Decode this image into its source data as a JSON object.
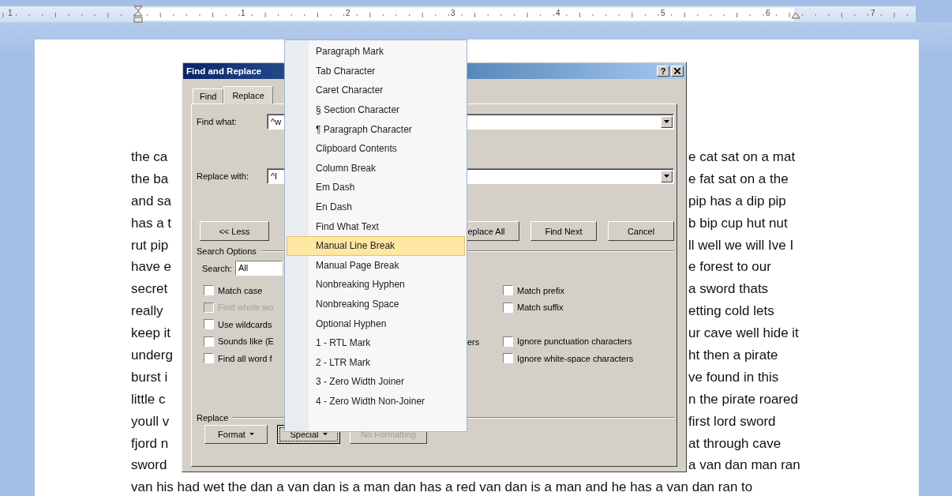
{
  "ruler": {
    "numbers": [
      "1",
      "1",
      "2",
      "3",
      "4",
      "5",
      "6",
      "7"
    ]
  },
  "document": {
    "lines": [
      {
        "left": "the ca",
        "right": "e cat sat on a mat"
      },
      {
        "left": "the ba",
        "right": "e fat sat on a the"
      },
      {
        "left": "and sa",
        "right": "pip has a dip pip"
      },
      {
        "left": "has a t",
        "right": "b bip cup hut nut"
      },
      {
        "left": "rut pip",
        "right": "ll well we will Ive I"
      },
      {
        "left": "have e",
        "right": "e forest to our"
      },
      {
        "left": "secret",
        "right": "a sword thats"
      },
      {
        "left": "really",
        "right": "etting cold lets"
      },
      {
        "left": "keep it",
        "right": "ur cave well hide it"
      },
      {
        "left": "underg",
        "right": "ht then a pirate"
      },
      {
        "left": "burst i",
        "right": "ve found in this"
      },
      {
        "left": "little c",
        "right": "n the pirate roared"
      },
      {
        "left": "youll v",
        "right": "first lord sword"
      },
      {
        "left": "fjord n",
        "right": "at through cave"
      },
      {
        "left": "sword",
        "right": "a van dan man ran"
      }
    ],
    "full_line": "van his had wet the dan a van dan is a man dan has a red van dan is a man and he has a van dan ran to"
  },
  "dialog": {
    "title": "Find and Replace",
    "help": "?",
    "tabs": [
      {
        "label": "Find",
        "selected": false
      },
      {
        "label": "Replace",
        "selected": true
      }
    ],
    "find_label": "Find what:",
    "find_value": "^w",
    "replace_label": "Replace with:",
    "replace_value": "^l",
    "less_button": "<< Less",
    "action_buttons": [
      "eplace All",
      "Find Next",
      "Cancel"
    ],
    "search_options_label": "Search Options",
    "search_label": "Search:",
    "search_value": "All",
    "option_rows": [
      {
        "left": {
          "label": "Match case",
          "checked": false,
          "disabled": false
        },
        "right": {
          "label": "Match prefix",
          "checked": false,
          "disabled": false
        }
      },
      {
        "left": {
          "label": "Find whole wo",
          "checked": false,
          "disabled": true
        },
        "right": {
          "label": "Match suffix",
          "checked": false,
          "disabled": false
        }
      },
      {
        "left": {
          "label": "Use wildcards",
          "checked": false,
          "disabled": false
        }
      },
      {
        "left": {
          "label": "Sounds like (E",
          "checked": false,
          "disabled": false
        },
        "middle": "ers",
        "right": {
          "label": "Ignore punctuation characters",
          "checked": false,
          "disabled": false
        }
      },
      {
        "left": {
          "label": "Find all word f",
          "checked": false,
          "disabled": false
        },
        "right": {
          "label": "Ignore white-space characters",
          "checked": false,
          "disabled": false
        }
      }
    ],
    "replace_group_label": "Replace",
    "replace_buttons": [
      {
        "label": "Format",
        "dropdown": true,
        "disabled": false,
        "focused": false
      },
      {
        "label": "Special",
        "dropdown": true,
        "disabled": false,
        "focused": true
      },
      {
        "label": "No Formatting",
        "dropdown": false,
        "disabled": true,
        "focused": false
      }
    ]
  },
  "special_menu": {
    "items": [
      {
        "label": "Paragraph Mark",
        "selected": false
      },
      {
        "label": "Tab Character",
        "selected": false
      },
      {
        "label": "Caret Character",
        "selected": false
      },
      {
        "label": "§ Section Character",
        "selected": false
      },
      {
        "label": "¶ Paragraph Character",
        "selected": false
      },
      {
        "label": "Clipboard Contents",
        "selected": false
      },
      {
        "label": "Column Break",
        "selected": false
      },
      {
        "label": "Em Dash",
        "selected": false
      },
      {
        "label": "En Dash",
        "selected": false
      },
      {
        "label": "Find What Text",
        "selected": false
      },
      {
        "label": "Manual Line Break",
        "selected": true
      },
      {
        "label": "Manual Page Break",
        "selected": false
      },
      {
        "label": "Nonbreaking Hyphen",
        "selected": false
      },
      {
        "label": "Nonbreaking Space",
        "selected": false
      },
      {
        "label": "Optional Hyphen",
        "selected": false
      },
      {
        "label": "1 - RTL Mark",
        "selected": false
      },
      {
        "label": "2 - LTR Mark",
        "selected": false
      },
      {
        "label": "3 - Zero Width Joiner",
        "selected": false
      },
      {
        "label": "4 - Zero Width Non-Joiner",
        "selected": false
      }
    ]
  }
}
